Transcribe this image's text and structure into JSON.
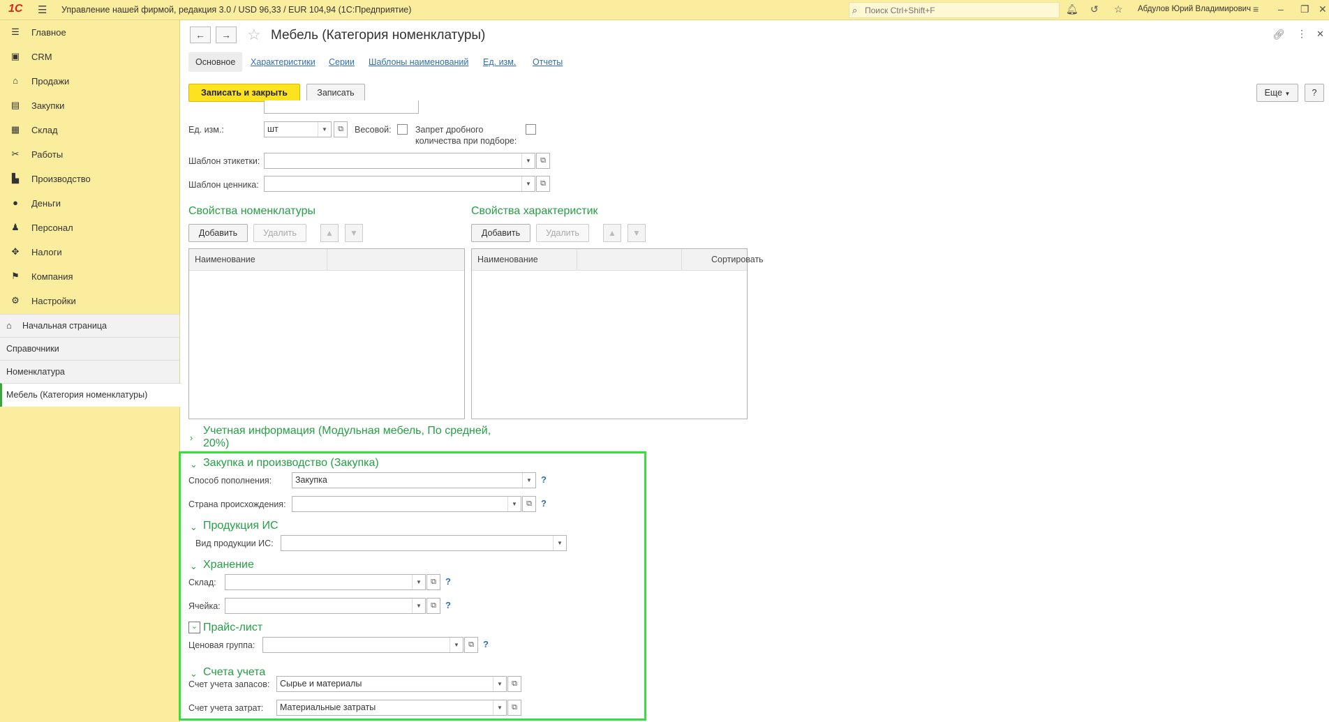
{
  "topbar": {
    "logo": "1С",
    "title": "Управление нашей фирмой, редакция 3.0 / USD 96,33 / EUR 104,94  (1С:Предприятие)",
    "search_placeholder": "Поиск Ctrl+Shift+F",
    "user": "Абдулов Юрий Владимирович"
  },
  "sidebar": {
    "items": [
      {
        "label": "Главное",
        "icon": "menu-icon"
      },
      {
        "label": "CRM",
        "icon": "crm-icon"
      },
      {
        "label": "Продажи",
        "icon": "sales-icon"
      },
      {
        "label": "Закупки",
        "icon": "purchases-icon"
      },
      {
        "label": "Склад",
        "icon": "warehouse-icon"
      },
      {
        "label": "Работы",
        "icon": "tools-icon"
      },
      {
        "label": "Производство",
        "icon": "production-icon"
      },
      {
        "label": "Деньги",
        "icon": "money-icon"
      },
      {
        "label": "Персонал",
        "icon": "staff-icon"
      },
      {
        "label": "Налоги",
        "icon": "taxes-icon"
      },
      {
        "label": "Компания",
        "icon": "flag-icon"
      },
      {
        "label": "Настройки",
        "icon": "gear-icon"
      }
    ],
    "opened": [
      {
        "label": "Начальная страница",
        "icon": "home-icon"
      },
      {
        "label": "Справочники"
      },
      {
        "label": "Номенклатура"
      },
      {
        "label": "Мебель (Категория номенклатуры)"
      }
    ]
  },
  "form": {
    "title": "Мебель (Категория номенклатуры)",
    "tabs": [
      "Основное",
      "Характеристики",
      "Серии",
      "Шаблоны наименований",
      "Ед. изм.",
      "Отчеты"
    ],
    "buttons": {
      "save_close": "Записать и закрыть",
      "save": "Записать",
      "more": "Еще",
      "help": "?"
    },
    "unit": {
      "label": "Ед. изм.:",
      "value": "шт"
    },
    "weight_label": "Весовой:",
    "fraction_label_1": "Запрет дробного",
    "fraction_label_2": "количества при подборе:",
    "label_template": {
      "label": "Шаблон этикетки:",
      "value": ""
    },
    "price_tag_template": {
      "label": "Шаблон ценника:",
      "value": ""
    },
    "props_nom": {
      "title": "Свойства номенклатуры",
      "add": "Добавить",
      "delete": "Удалить",
      "col1": "Наименование"
    },
    "props_char": {
      "title": "Свойства характеристик",
      "add": "Добавить",
      "delete": "Удалить",
      "col1": "Наименование",
      "col3": "Сортировать"
    },
    "accounting_info": {
      "line1": "Учетная информация (Модульная мебель, По средней,",
      "line2": "20%)"
    },
    "purchase": {
      "title": "Закупка и производство (Закупка)",
      "replenishment": {
        "label": "Способ пополнения:",
        "value": "Закупка"
      },
      "country": {
        "label": "Страна происхождения:",
        "value": ""
      }
    },
    "is_products": {
      "title": "Продукция ИС",
      "kind_label": "Вид продукции ИС:",
      "value": ""
    },
    "storage": {
      "title": "Хранение",
      "warehouse": {
        "label": "Склад:",
        "value": ""
      },
      "cell": {
        "label": "Ячейка:",
        "value": ""
      }
    },
    "pricelist": {
      "title": "Прайс-лист",
      "price_group": {
        "label": "Ценовая группа:",
        "value": ""
      }
    },
    "accounts": {
      "title": "Счета учета",
      "inventory": {
        "label": "Счет учета запасов:",
        "value": "Сырье и материалы"
      },
      "expenses": {
        "label": "Счет учета затрат:",
        "value": "Материальные затраты"
      }
    }
  },
  "colors": {
    "accent_green": "#25a045",
    "highlight": "#35e03b",
    "primary_button": "#fde21f",
    "sidebar": "#fbed9e"
  }
}
